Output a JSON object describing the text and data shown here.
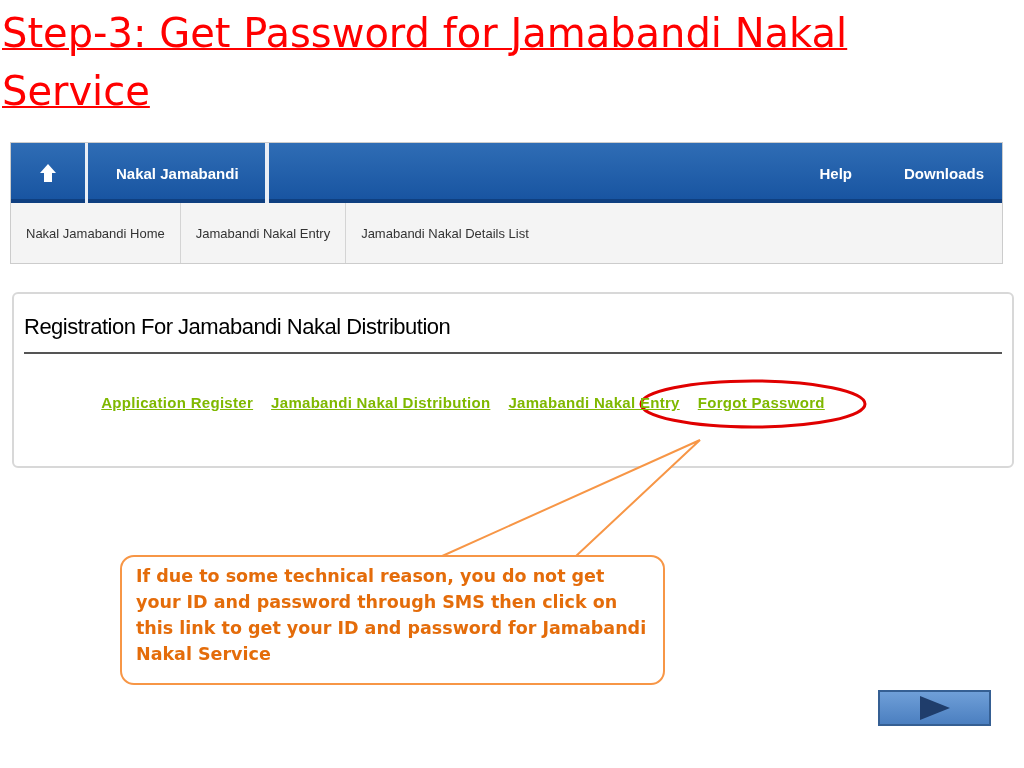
{
  "slide_title": "Step-3: Get Password for Jamabandi Nakal Service",
  "nav_bar": {
    "tabs": [
      {
        "label": "Nakal Jamabandi",
        "selected": true
      }
    ],
    "right_links": [
      "Help",
      "Downloads"
    ]
  },
  "sub_nav": [
    "Nakal Jamabandi Home",
    "Jamabandi Nakal Entry",
    "Jamabandi Nakal Details List"
  ],
  "panel": {
    "title": "Registration For Jamabandi Nakal Distribution",
    "links": [
      {
        "label": "Application Register",
        "highlighted": false
      },
      {
        "label": "Jamabandi Nakal Distribution",
        "highlighted": false
      },
      {
        "label": "Jamabandi Nakal Entry",
        "highlighted": false
      },
      {
        "label": "Forgot Password",
        "highlighted": true
      }
    ]
  },
  "callout": "If due to some technical reason, you do not get your ID and password through SMS  then click on this link to get your ID and password for Jamabandi Nakal Service"
}
